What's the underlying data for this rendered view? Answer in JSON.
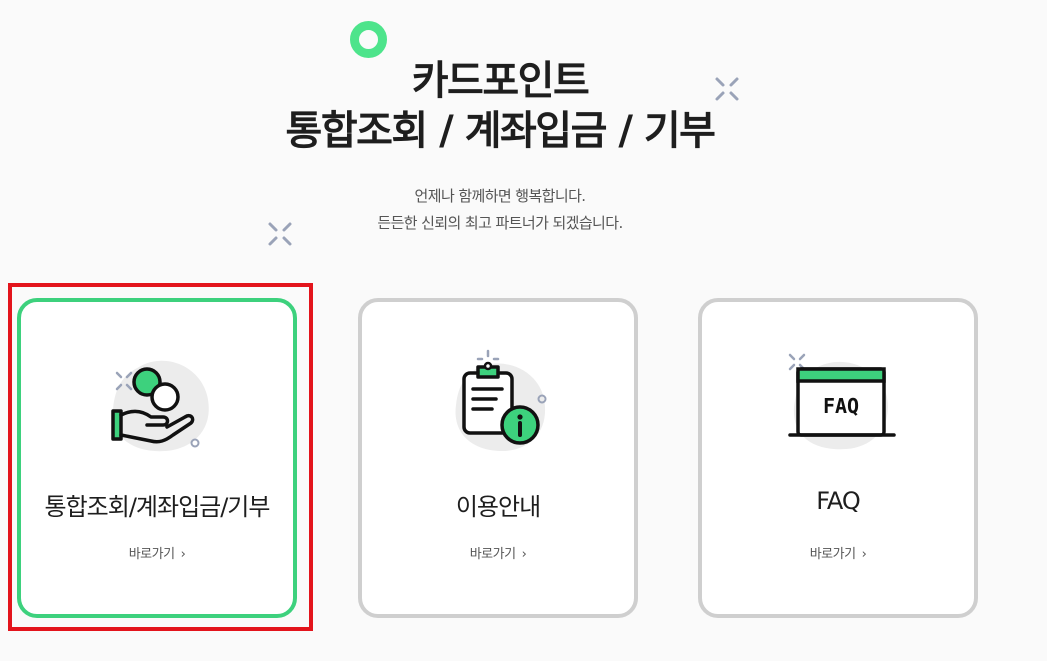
{
  "hero": {
    "title_line1": "카드포인트",
    "title_line2": "통합조회 / 계좌입금 / 기부",
    "subtitle_line1": "언제나 함께하면 행복합니다.",
    "subtitle_line2": "든든한 신뢰의 최고 파트너가 되겠습니다."
  },
  "cards": [
    {
      "title": "통합조회/계좌입금/기부",
      "link_label": "바로가기",
      "icon": "hand-coins-icon",
      "selected": true
    },
    {
      "title": "이용안내",
      "link_label": "바로가기",
      "icon": "clipboard-info-icon",
      "selected": false
    },
    {
      "title": "FAQ",
      "link_label": "바로가기",
      "icon": "faq-board-icon",
      "selected": false,
      "icon_text": "FAQ"
    }
  ],
  "colors": {
    "accent_green": "#3dd17d",
    "highlight_red": "#e3141c",
    "card_border": "#cfcfcf",
    "sparkle": "#9aa3b8"
  }
}
